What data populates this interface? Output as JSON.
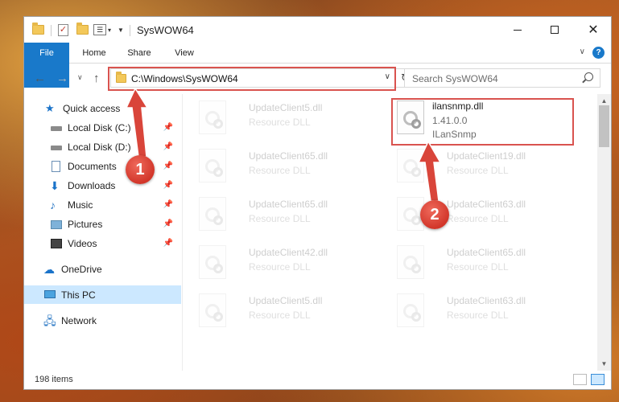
{
  "window": {
    "title": "SysWOW64"
  },
  "ribbon": {
    "tabs": [
      {
        "label": "File"
      },
      {
        "label": "Home"
      },
      {
        "label": "Share"
      },
      {
        "label": "View"
      }
    ],
    "help_label": "?"
  },
  "navigation": {
    "address_path": "C:\\Windows\\SysWOW64",
    "search_placeholder": "Search SysWOW64"
  },
  "sidebar": {
    "items": [
      {
        "label": "Quick access",
        "icon": "star-icon",
        "pinned": false
      },
      {
        "label": "Local Disk (C:)",
        "icon": "drive-icon",
        "pinned": true
      },
      {
        "label": "Local Disk (D:)",
        "icon": "drive-icon",
        "pinned": true
      },
      {
        "label": "Documents",
        "icon": "documents-icon",
        "pinned": true
      },
      {
        "label": "Downloads",
        "icon": "download-icon",
        "pinned": true
      },
      {
        "label": "Music",
        "icon": "music-icon",
        "pinned": true
      },
      {
        "label": "Pictures",
        "icon": "pictures-icon",
        "pinned": true
      },
      {
        "label": "Videos",
        "icon": "videos-icon",
        "pinned": true
      },
      {
        "label": "OneDrive",
        "icon": "cloud-icon",
        "pinned": false
      },
      {
        "label": "This PC",
        "icon": "computer-icon",
        "pinned": false,
        "selected": true
      },
      {
        "label": "Network",
        "icon": "network-icon",
        "pinned": false
      }
    ]
  },
  "files": {
    "highlighted": {
      "name": "ilansnmp.dll",
      "version": "1.41.0.0",
      "description": "ILanSnmp"
    },
    "left_column": [
      {
        "name": "UpdateClient5.dll",
        "type": "Resource DLL"
      },
      {
        "name": "UpdateClient65.dll",
        "type": "Resource DLL"
      },
      {
        "name": "UpdateClient65.dll",
        "type": "Resource DLL"
      },
      {
        "name": "UpdateClient42.dll",
        "type": "Resource DLL"
      },
      {
        "name": "UpdateClient5.dll",
        "type": "Resource DLL"
      }
    ],
    "right_column": [
      {
        "name": "UpdateClient19.dll",
        "type": "Resource DLL"
      },
      {
        "name": "UpdateClient63.dll",
        "type": "Resource DLL"
      },
      {
        "name": "UpdateClient65.dll",
        "type": "Resource DLL"
      },
      {
        "name": "UpdateClient63.dll",
        "type": "Resource DLL"
      }
    ]
  },
  "status": {
    "item_count": "198 items"
  },
  "annotations": {
    "step1": "1",
    "step2": "2"
  },
  "colors": {
    "accent": "#1979ca",
    "highlight_border": "#d9534f",
    "badge": "#d2362a",
    "selection": "#cce8ff"
  }
}
